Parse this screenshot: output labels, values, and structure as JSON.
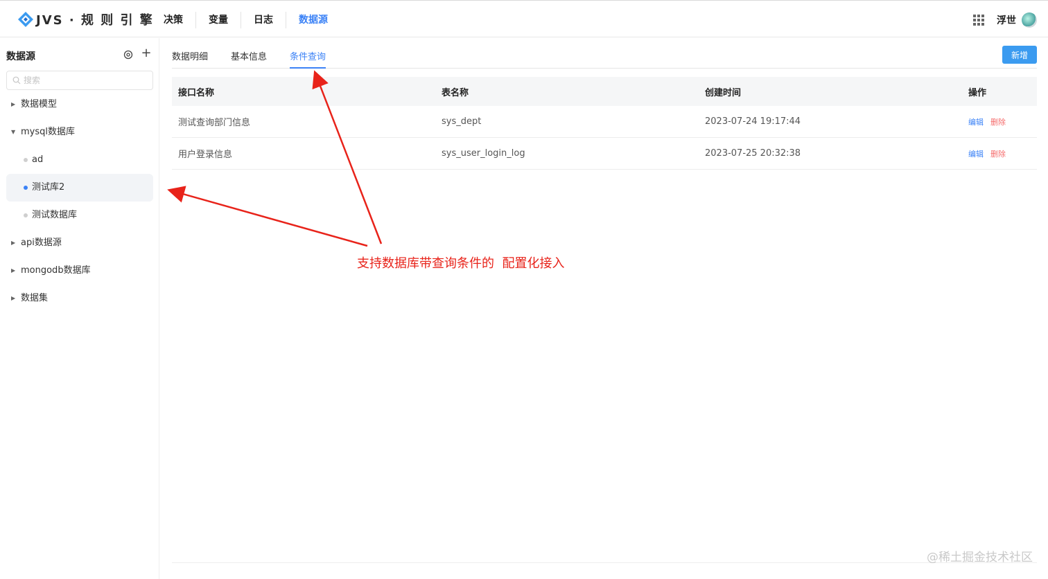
{
  "header": {
    "logo_text": "JVS · 规 则 引 擎",
    "nav": [
      "决策",
      "变量",
      "日志",
      "数据源"
    ],
    "active_nav_index": 3,
    "user_name": "浮世"
  },
  "sidebar": {
    "title": "数据源",
    "search_placeholder": "搜索",
    "items": [
      {
        "label": "数据模型",
        "level": 0,
        "expanded": false
      },
      {
        "label": "mysql数据库",
        "level": 0,
        "expanded": true
      },
      {
        "label": "ad",
        "level": 1,
        "selected": false
      },
      {
        "label": "测试库2",
        "level": 1,
        "selected": true
      },
      {
        "label": "测试数据库",
        "level": 1,
        "selected": false
      },
      {
        "label": "api数据源",
        "level": 0,
        "expanded": false
      },
      {
        "label": "mongodb数据库",
        "level": 0,
        "expanded": false
      },
      {
        "label": "数据集",
        "level": 0,
        "expanded": false
      }
    ]
  },
  "main": {
    "tabs": [
      "数据明细",
      "基本信息",
      "条件查询"
    ],
    "active_tab_index": 2,
    "add_button": "新增",
    "table": {
      "columns": [
        "接口名称",
        "表名称",
        "创建时间",
        "操作"
      ],
      "rows": [
        {
          "name": "测试查询部门信息",
          "table": "sys_dept",
          "created": "2023-07-24 19:17:44",
          "edit": "编辑",
          "delete": "删除"
        },
        {
          "name": "用户登录信息",
          "table": "sys_user_login_log",
          "created": "2023-07-25 20:32:38",
          "edit": "编辑",
          "delete": "删除"
        }
      ]
    }
  },
  "annotation": {
    "text": "支持数据库带查询条件的  配置化接入",
    "color": "#e8231a"
  },
  "watermark": "@稀土掘金技术社区",
  "colors": {
    "accent": "#3b82f6",
    "button": "#3b9bf0",
    "danger": "#f56c6c"
  }
}
